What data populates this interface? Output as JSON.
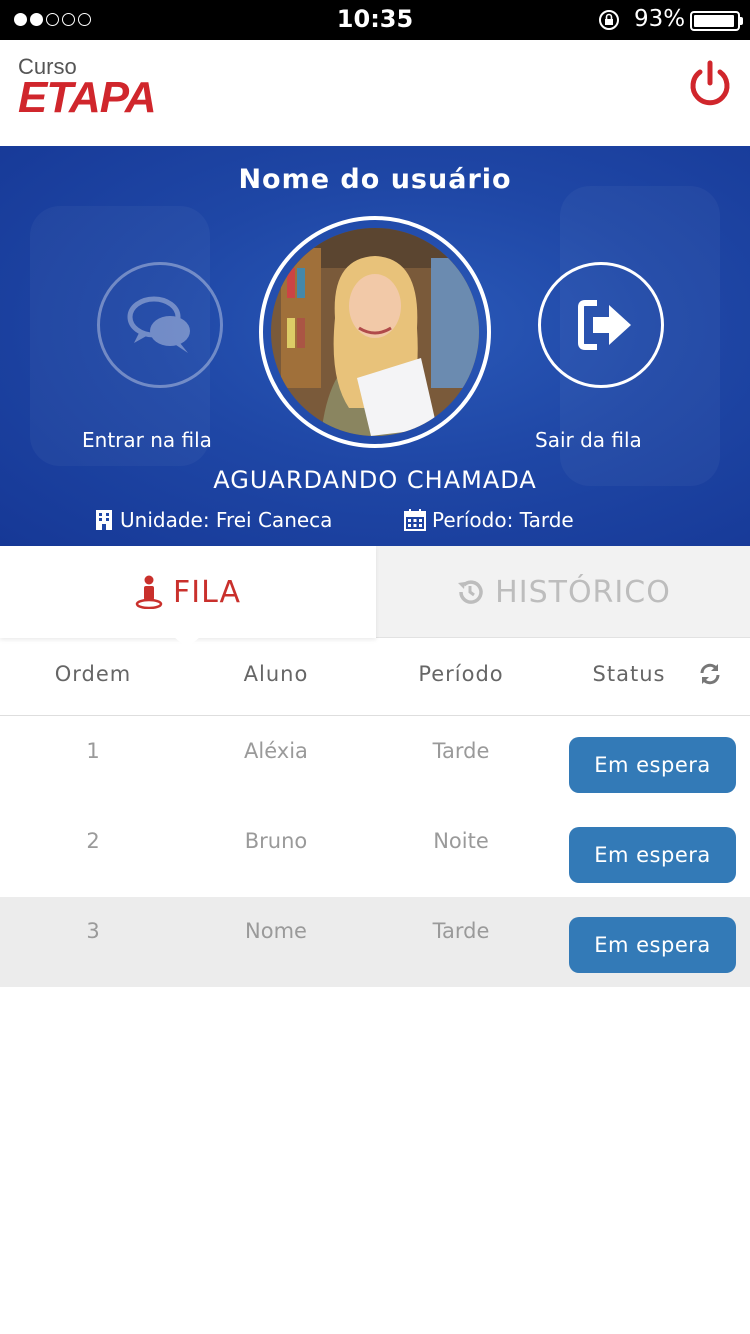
{
  "status_bar": {
    "time": "10:35",
    "battery_percent": "93%",
    "signal_strength": 2,
    "battery_level": 0.93
  },
  "header": {
    "logo_small": "Curso",
    "logo_big": "ETAPA",
    "brand_color": "#d0262c",
    "power_icon": "power-icon"
  },
  "profile": {
    "user_name": "Nome do usuário",
    "enter_queue_label": "Entrar na fila",
    "exit_queue_label": "Sair da fila",
    "call_status": "AGUARDANDO CHAMADA",
    "unit": "Unidade: Frei Caneca",
    "period": "Período: Tarde",
    "hero_color": "#1f47a6"
  },
  "tabs": {
    "fila": "FILA",
    "historico": "HISTÓRICO",
    "active": "FILA"
  },
  "table": {
    "headers": [
      "Ordem",
      "Aluno",
      "Período",
      "Status"
    ],
    "rows": [
      {
        "order": "1",
        "student": "Aléxia",
        "period": "Tarde",
        "status": "Em espera"
      },
      {
        "order": "2",
        "student": "Bruno",
        "period": "Noite",
        "status": "Em espera"
      },
      {
        "order": "3",
        "student": "Nome",
        "period": "Tarde",
        "status": "Em espera"
      }
    ],
    "status_color": "#337ab7"
  }
}
